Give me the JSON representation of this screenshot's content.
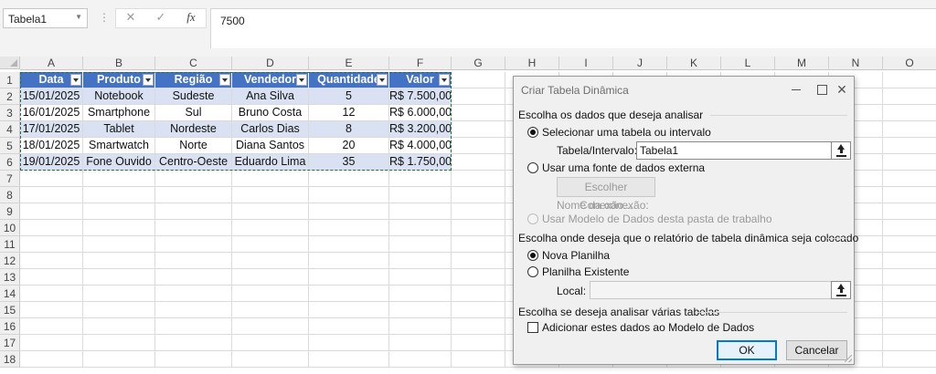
{
  "formula_bar": {
    "name_box": "Tabela1",
    "cancel_glyph": "✕",
    "enter_glyph": "✓",
    "fx_glyph": "fx",
    "value": "7500"
  },
  "sheet": {
    "columns": [
      "A",
      "B",
      "C",
      "D",
      "E",
      "F",
      "G",
      "H",
      "I",
      "J",
      "K",
      "L",
      "M",
      "N",
      "O"
    ],
    "rows": [
      "1",
      "2",
      "3",
      "4",
      "5",
      "6",
      "7",
      "8",
      "9",
      "10",
      "11",
      "12",
      "13",
      "14",
      "15",
      "16",
      "17",
      "18"
    ],
    "table": {
      "headers": [
        "Data",
        "Produto",
        "Região",
        "Vendedor",
        "Quantidade",
        "Valor"
      ],
      "rows": [
        [
          "15/01/2025",
          "Notebook",
          "Sudeste",
          "Ana Silva",
          "5",
          "R$ 7.500,00"
        ],
        [
          "16/01/2025",
          "Smartphone",
          "Sul",
          "Bruno Costa",
          "12",
          "R$ 6.000,00"
        ],
        [
          "17/01/2025",
          "Tablet",
          "Nordeste",
          "Carlos Dias",
          "8",
          "R$ 3.200,00"
        ],
        [
          "18/01/2025",
          "Smartwatch",
          "Norte",
          "Diana Santos",
          "20",
          "R$ 4.000,00"
        ],
        [
          "19/01/2025",
          "Fone Ouvido",
          "Centro-Oeste",
          "Eduardo Lima",
          "35",
          "R$ 1.750,00"
        ]
      ]
    },
    "colors": {
      "header_fill": "#4472c4",
      "band_fill": "#d9e1f2",
      "marquee": "#1e7145"
    }
  },
  "dialog": {
    "title": "Criar Tabela Dinâmica",
    "close_glyph": "✕",
    "section1": "Escolha os dados que deseja analisar",
    "opt_select_table": "Selecionar uma tabela ou intervalo",
    "table_range_label": "Tabela/Intervalo:",
    "table_range_value": "Tabela1",
    "opt_external": "Usar uma fonte de dados externa",
    "choose_connection": "Escolher Conexão...",
    "connection_name_label": "Nome da conexão:",
    "opt_data_model": "Usar Modelo de Dados desta pasta de trabalho",
    "section2": "Escolha onde deseja que o relatório de tabela dinâmica seja colocado",
    "opt_new_sheet": "Nova Planilha",
    "opt_existing_sheet": "Planilha Existente",
    "local_label": "Local:",
    "local_value": "",
    "section3": "Escolha se deseja analisar várias tabelas",
    "add_to_model": "Adicionar estes dados ao Modelo de Dados",
    "ok": "OK",
    "cancel": "Cancelar"
  }
}
